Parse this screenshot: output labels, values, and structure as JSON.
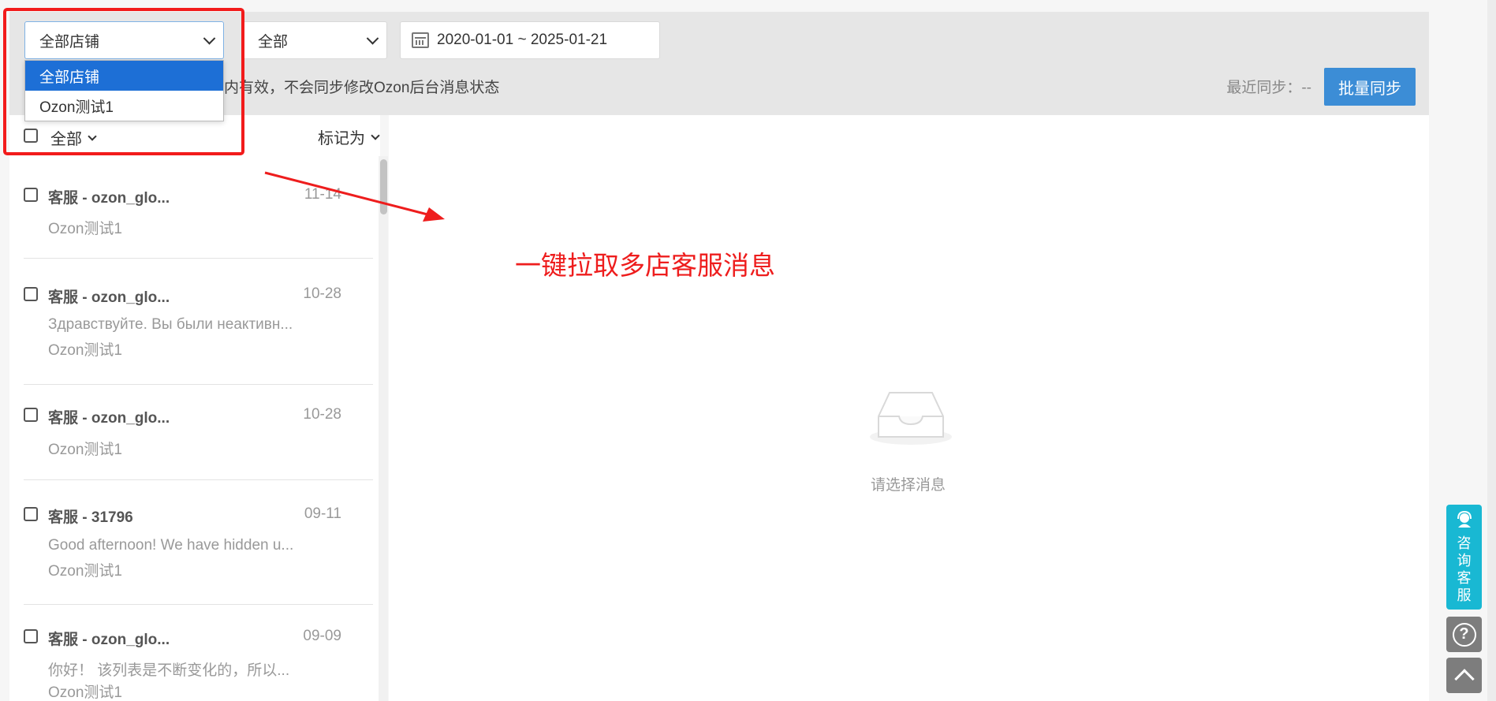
{
  "filters": {
    "shop_select_value": "全部店铺",
    "status_select_value": "全部",
    "date_range": "2020-01-01 ~ 2025-01-21"
  },
  "shop_menu": {
    "options": [
      "全部店铺",
      "Ozon测试1"
    ],
    "selected": "全部店铺"
  },
  "notice_text": "内有效，不会同步修改Ozon后台消息状态",
  "last_sync": "最近同步：--",
  "batch_sync_label": "批量同步",
  "list_header": {
    "filter_label": "全部",
    "mark_as_label": "标记为"
  },
  "messages": [
    {
      "title": "客服 - ozon_glo...",
      "date": "11-14",
      "preview": "",
      "shop": "Ozon测试1"
    },
    {
      "title": "客服 - ozon_glo...",
      "date": "10-28",
      "preview": "Здравствуйте. Вы были неактивн...",
      "shop": "Ozon测试1"
    },
    {
      "title": "客服 - ozon_glo...",
      "date": "10-28",
      "preview": "",
      "shop": "Ozon测试1"
    },
    {
      "title": "客服 - 31796",
      "date": "09-11",
      "preview": "Good afternoon! We have hidden u...",
      "shop": "Ozon测试1"
    },
    {
      "title": "客服 - ozon_glo...",
      "date": "09-09",
      "preview": "你好！ 该列表是不断变化的，所以...",
      "shop": "Ozon测试1"
    }
  ],
  "annotation_text": "一键拉取多店客服消息",
  "empty_state_text": "请选择消息",
  "consult_label": "咨询客服",
  "colors": {
    "primary": "#3c8dd6",
    "menu_active": "#1d6fd6",
    "annotation_red": "#ee1d1d",
    "consult_teal": "#19b8d3"
  },
  "icons": [
    "chevron-down-icon",
    "calendar-icon",
    "empty-inbox-icon",
    "headset-icon",
    "help-icon",
    "back-to-top-icon",
    "annotation-arrow"
  ]
}
